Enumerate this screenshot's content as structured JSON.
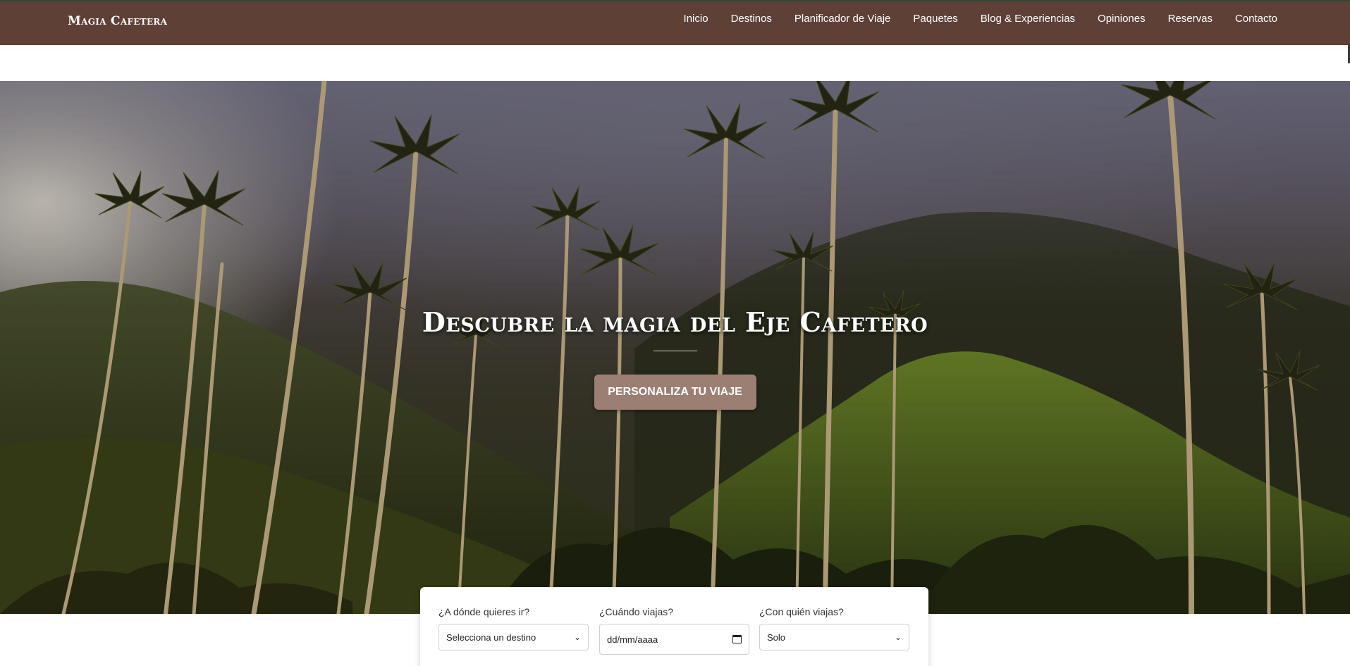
{
  "navbar": {
    "brand": "Magia Cafetera",
    "links": [
      "Inicio",
      "Destinos",
      "Planificador de Viaje",
      "Paquetes",
      "Blog & Experiencias",
      "Opiniones",
      "Reservas",
      "Contacto"
    ],
    "background_color": "#5e4037"
  },
  "hero": {
    "title": "Descubre la magia del Eje Cafetero",
    "cta_label": "Personaliza tu viaje",
    "cta_color": "#9c7f73"
  },
  "search": {
    "destination": {
      "label": "¿A dónde quieres ir?",
      "value": "Selecciona un destino"
    },
    "date": {
      "label": "¿Cuándo viajas?",
      "value": "dd/mm/aaaa"
    },
    "companions": {
      "label": "¿Con quién viajas?",
      "value": "Solo"
    }
  }
}
